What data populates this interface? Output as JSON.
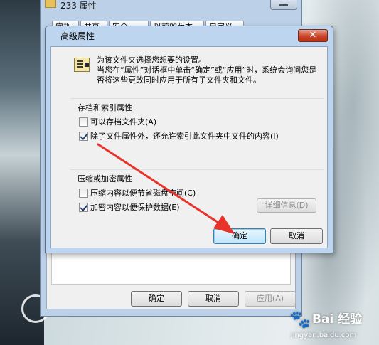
{
  "properties_window": {
    "title": "233 属性",
    "tabs": [
      "常规",
      "共享",
      "安全",
      "以前的版本",
      "自定义"
    ],
    "buttons": {
      "ok": "确定",
      "cancel": "取消",
      "apply": "应用(A)"
    }
  },
  "advanced_dialog": {
    "title": "高级属性",
    "close_icon": "✕",
    "instruction": "为该文件夹选择您想要的设置。",
    "description": "当您在“属性”对话框中单击“确定”或“应用”时，系统会询问您是否将这些更改同时应用于所有子文件夹和文件。",
    "archive_group": {
      "label": "存档和索引属性",
      "archive": {
        "label": "可以存档文件夹(A)",
        "checked": false
      },
      "index": {
        "label": "除了文件属性外，还允许索引此文件夹中文件的内容(I)",
        "checked": true
      }
    },
    "compress_group": {
      "label": "压缩或加密属性",
      "compress": {
        "label": "压缩内容以便节省磁盘空间(C)",
        "checked": false
      },
      "encrypt": {
        "label": "加密内容以便保护数据(E)",
        "checked": true
      },
      "details_button": "详细信息(D)"
    },
    "ok_button": "确定",
    "cancel_button": "取消"
  },
  "annotation_arrow": {
    "color": "#e8332a"
  },
  "watermark": {
    "name": "Bai 经验",
    "url": "jingyan.baidu.com"
  }
}
